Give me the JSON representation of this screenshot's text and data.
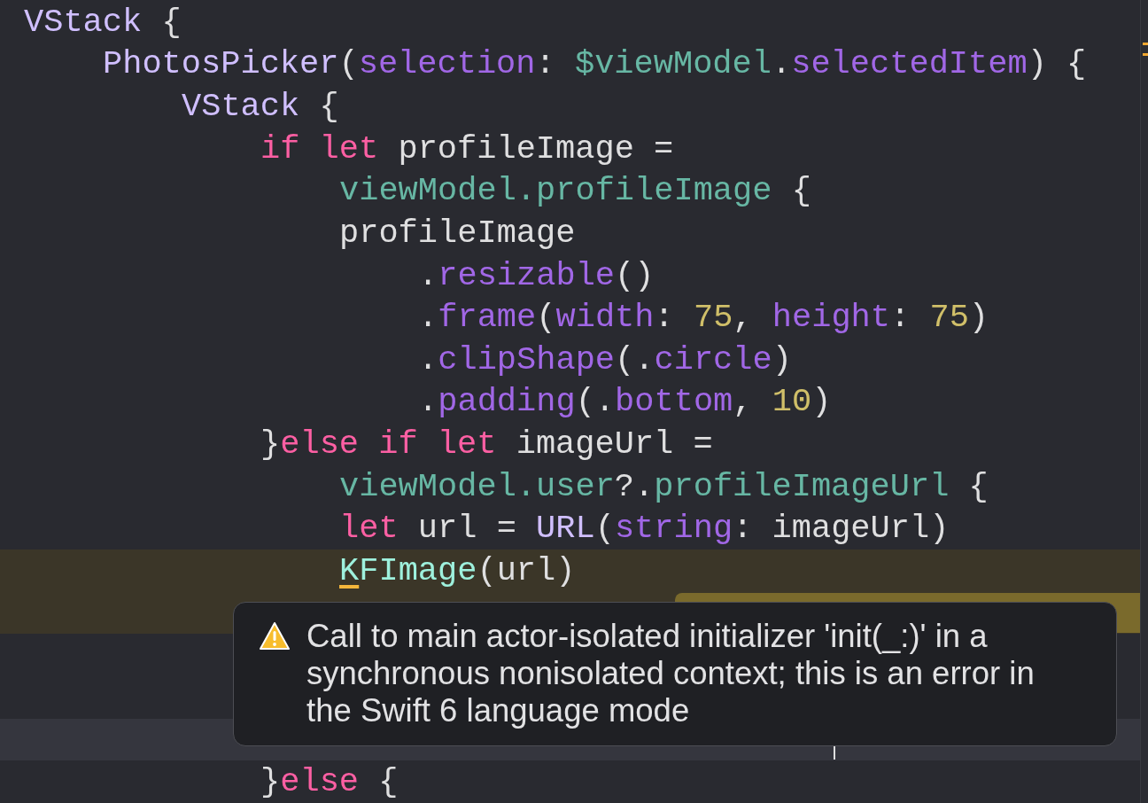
{
  "editor": {
    "lines": [
      {
        "kind": "code",
        "highlighted": false,
        "current": false,
        "tokens": [
          {
            "text": "VStack",
            "kind": "type"
          },
          {
            "text": " {",
            "kind": "plain"
          }
        ],
        "children": [
          {
            "kind": "code",
            "highlighted": false,
            "current": false,
            "tokens": [
              {
                "text": "PhotosPicker",
                "kind": "type"
              },
              {
                "text": "(",
                "kind": "plain"
              },
              {
                "text": "selection",
                "kind": "member"
              },
              {
                "text": ": ",
                "kind": "plain"
              },
              {
                "text": "$viewModel",
                "kind": "project"
              },
              {
                "text": ".",
                "kind": "plain"
              },
              {
                "text": "selectedItem",
                "kind": "member"
              },
              {
                "text": ") {",
                "kind": "plain"
              }
            ],
            "children": [
              {
                "kind": "code",
                "highlighted": false,
                "current": false,
                "tokens": [
                  {
                    "text": "VStack",
                    "kind": "type"
                  },
                  {
                    "text": " {",
                    "kind": "plain"
                  }
                ],
                "children": [
                  {
                    "kind": "code",
                    "highlighted": false,
                    "current": false,
                    "tokens": [
                      {
                        "text": "if let",
                        "kind": "keyword"
                      },
                      {
                        "text": " profileImage =",
                        "kind": "plain"
                      }
                    ],
                    "children": [
                      {
                        "kind": "code",
                        "highlighted": false,
                        "current": false,
                        "tokens": [
                          {
                            "text": "viewModel.profileImage",
                            "kind": "project"
                          },
                          {
                            "text": " {",
                            "kind": "plain"
                          }
                        ]
                      },
                      {
                        "kind": "code",
                        "highlighted": false,
                        "current": false,
                        "tokens": [
                          {
                            "text": "profileImage",
                            "kind": "plain"
                          }
                        ],
                        "children": [
                          {
                            "kind": "code",
                            "highlighted": false,
                            "current": false,
                            "tokens": [
                              {
                                "text": ".",
                                "kind": "plain"
                              },
                              {
                                "text": "resizable",
                                "kind": "member"
                              },
                              {
                                "text": "()",
                                "kind": "plain"
                              }
                            ]
                          },
                          {
                            "kind": "code",
                            "highlighted": false,
                            "current": false,
                            "tokens": [
                              {
                                "text": ".",
                                "kind": "plain"
                              },
                              {
                                "text": "frame",
                                "kind": "member"
                              },
                              {
                                "text": "(",
                                "kind": "plain"
                              },
                              {
                                "text": "width",
                                "kind": "member"
                              },
                              {
                                "text": ": ",
                                "kind": "plain"
                              },
                              {
                                "text": "75",
                                "kind": "number"
                              },
                              {
                                "text": ", ",
                                "kind": "plain"
                              },
                              {
                                "text": "height",
                                "kind": "member"
                              },
                              {
                                "text": ": ",
                                "kind": "plain"
                              },
                              {
                                "text": "75",
                                "kind": "number"
                              },
                              {
                                "text": ")",
                                "kind": "plain"
                              }
                            ]
                          },
                          {
                            "kind": "code",
                            "highlighted": false,
                            "current": false,
                            "tokens": [
                              {
                                "text": ".",
                                "kind": "plain"
                              },
                              {
                                "text": "clipShape",
                                "kind": "member"
                              },
                              {
                                "text": "(.",
                                "kind": "plain"
                              },
                              {
                                "text": "circle",
                                "kind": "member"
                              },
                              {
                                "text": ")",
                                "kind": "plain"
                              }
                            ]
                          },
                          {
                            "kind": "code",
                            "highlighted": false,
                            "current": false,
                            "tokens": [
                              {
                                "text": ".",
                                "kind": "plain"
                              },
                              {
                                "text": "padding",
                                "kind": "member"
                              },
                              {
                                "text": "(.",
                                "kind": "plain"
                              },
                              {
                                "text": "bottom",
                                "kind": "member"
                              },
                              {
                                "text": ", ",
                                "kind": "plain"
                              },
                              {
                                "text": "10",
                                "kind": "number"
                              },
                              {
                                "text": ")",
                                "kind": "plain"
                              }
                            ]
                          }
                        ]
                      }
                    ]
                  },
                  {
                    "kind": "code",
                    "highlighted": false,
                    "current": false,
                    "tokens": [
                      {
                        "text": "}",
                        "kind": "plain"
                      },
                      {
                        "text": "else if let",
                        "kind": "keyword"
                      },
                      {
                        "text": " imageUrl =",
                        "kind": "plain"
                      }
                    ],
                    "children": [
                      {
                        "kind": "code",
                        "highlighted": false,
                        "current": false,
                        "tokens": [
                          {
                            "text": "viewModel.user",
                            "kind": "project"
                          },
                          {
                            "text": "?.",
                            "kind": "plain"
                          },
                          {
                            "text": "profileImageUrl",
                            "kind": "project"
                          },
                          {
                            "text": " {",
                            "kind": "plain"
                          }
                        ]
                      },
                      {
                        "kind": "code",
                        "highlighted": false,
                        "current": false,
                        "tokens": [
                          {
                            "text": "let",
                            "kind": "keyword"
                          },
                          {
                            "text": " url = ",
                            "kind": "plain"
                          },
                          {
                            "text": "URL",
                            "kind": "type"
                          },
                          {
                            "text": "(",
                            "kind": "plain"
                          },
                          {
                            "text": "string",
                            "kind": "member"
                          },
                          {
                            "text": ": imageUrl)",
                            "kind": "plain"
                          }
                        ]
                      },
                      {
                        "kind": "code",
                        "highlighted": true,
                        "current": false,
                        "tokens": [
                          {
                            "text": "K",
                            "kind": "class",
                            "flagged": true
                          },
                          {
                            "text": "FImage",
                            "kind": "class"
                          },
                          {
                            "text": "(url)",
                            "kind": "plain"
                          }
                        ],
                        "children": [
                          {
                            "kind": "covered",
                            "highlighted": true,
                            "current": false,
                            "banner": true
                          },
                          {
                            "kind": "covered",
                            "highlighted": false,
                            "current": false,
                            "banner": false
                          },
                          {
                            "kind": "covered",
                            "highlighted": false,
                            "current": false,
                            "banner": false
                          },
                          {
                            "kind": "covered",
                            "highlighted": false,
                            "current": true,
                            "banner": false
                          }
                        ]
                      }
                    ]
                  },
                  {
                    "kind": "code",
                    "highlighted": false,
                    "current": false,
                    "tokens": [
                      {
                        "text": "}",
                        "kind": "plain"
                      },
                      {
                        "text": "else",
                        "kind": "keyword"
                      },
                      {
                        "text": " {",
                        "kind": "plain"
                      }
                    ]
                  }
                ]
              }
            ]
          }
        ]
      }
    ]
  },
  "popover": {
    "message": "Call to main actor-isolated initializer 'init(_:)' in a synchronous nonisolated context; this is an error in the Swift 6 language mode"
  }
}
